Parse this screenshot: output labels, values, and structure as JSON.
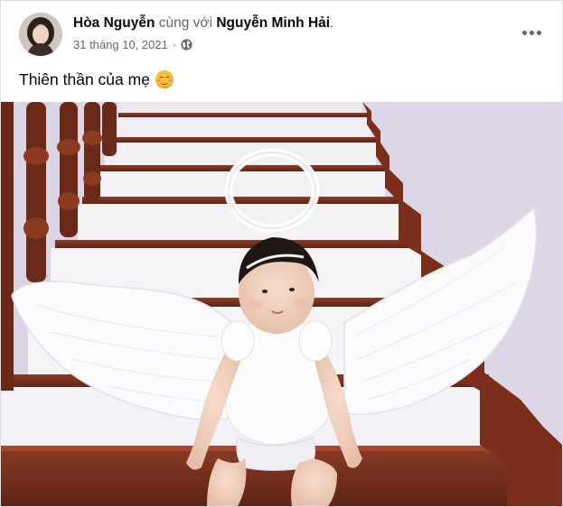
{
  "post": {
    "author": "Hòa Nguyễn",
    "with_text": "cùng với",
    "tagged": "Nguyễn Minh Hải",
    "tagged_suffix": ".",
    "date": "31 tháng 10, 2021",
    "separator": "·",
    "privacy_icon": "globe-icon",
    "more_icon": "more-horizontal-icon",
    "caption": "Thiên thần của mẹ",
    "caption_emoji": "smiling-face-with-smiling-eyes"
  },
  "colors": {
    "text_primary": "#050505",
    "text_secondary": "#65676b",
    "card_border": "#dddfe2"
  }
}
